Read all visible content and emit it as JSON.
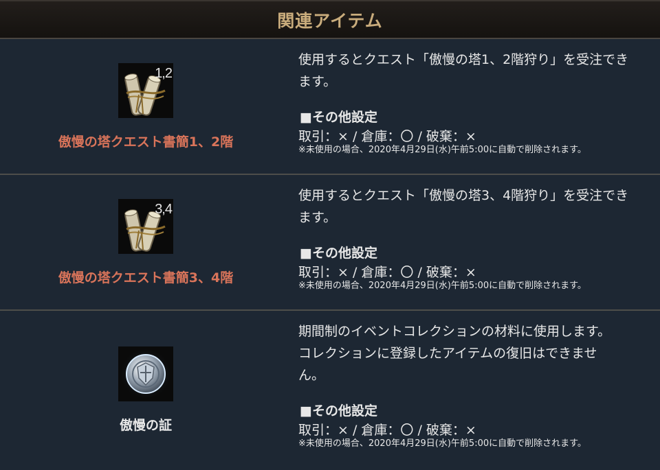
{
  "header": {
    "title": "関連アイテム"
  },
  "section_label": "■その他設定",
  "items": [
    {
      "name": "傲慢の塔クエスト書簡1、2階",
      "icon": "scroll-icon",
      "icon_number": "1,2",
      "description": "使用するとクエスト「傲慢の塔1、2階狩り」を受注でき\nます。",
      "settings": "取引：× / 倉庫：〇 / 破棄：×",
      "note": "※未使用の場合、2020年4月29日(水)午前5:00に自動で削除されます。"
    },
    {
      "name": "傲慢の塔クエスト書簡3、4階",
      "icon": "scroll-icon",
      "icon_number": "3,4",
      "description": "使用するとクエスト「傲慢の塔3、4階狩り」を受注でき\nます。",
      "settings": "取引：× / 倉庫：〇 / 破棄：×",
      "note": "※未使用の場合、2020年4月29日(水)午前5:00に自動で削除されます。"
    },
    {
      "name": "傲慢の証",
      "icon": "silver-coin-icon",
      "description": "期間制のイベントコレクションの材料に使用します。\nコレクションに登録したアイテムの復旧はできませ\nん。",
      "settings": "取引：× / 倉庫：〇 / 破棄：×",
      "note": "※未使用の場合、2020年4月29日(水)午前5:00に自動で削除されます。"
    }
  ],
  "colors": {
    "name_red": "#d9745a",
    "header_gold": "#c9ac7c",
    "bg": "#1d2733"
  }
}
